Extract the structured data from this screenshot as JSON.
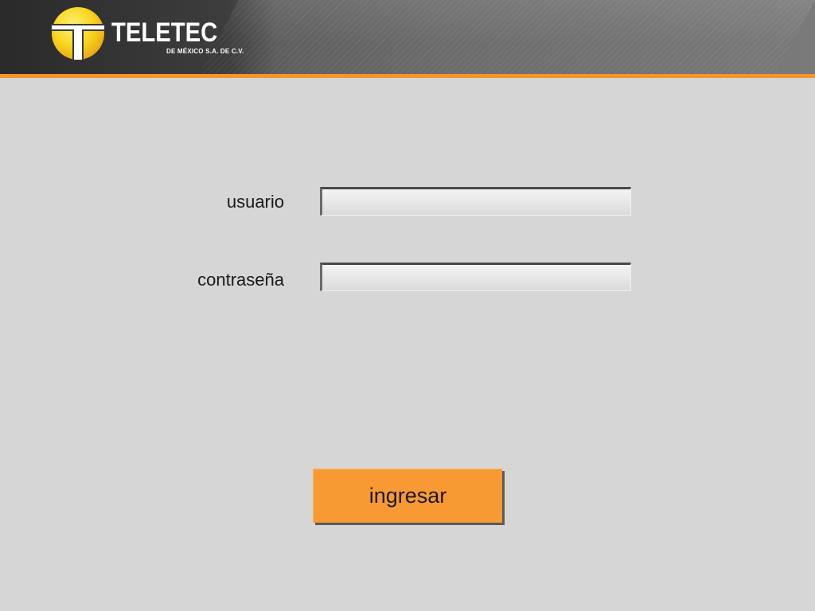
{
  "brand": {
    "name": "TELETEC",
    "subtitle": "DE MÉXICO S.A. DE C.V.",
    "logo_icon": "teletec-logo-icon",
    "accent_color": "#f4942b",
    "logo_yellow": "#f7d21b"
  },
  "form": {
    "username_label": "usuario",
    "username_value": "",
    "username_placeholder": "",
    "password_label": "contraseña",
    "password_value": "",
    "password_placeholder": "",
    "submit_label": "ingresar",
    "submit_color": "#f89a33"
  }
}
